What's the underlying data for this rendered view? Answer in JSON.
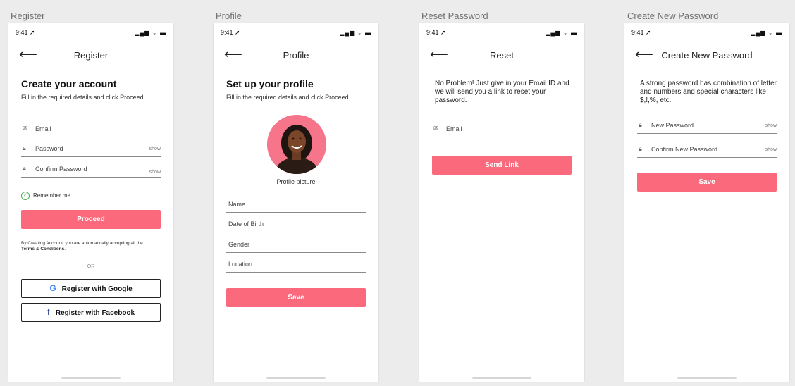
{
  "frames": [
    {
      "label": "Register"
    },
    {
      "label": "Profile"
    },
    {
      "label": "Reset Password"
    },
    {
      "label": "Create New Password"
    }
  ],
  "status": {
    "time": "9:41 ➚",
    "icons": "▂▄▆ ᯤ ▬"
  },
  "register": {
    "nav_title": "Register",
    "heading": "Create your account",
    "subtext": "Fill in the required details and click Proceed.",
    "email_label": "Email",
    "password_label": "Password",
    "password_show": "show",
    "confirm_label": "Confirm Password",
    "confirm_show": "show",
    "remember_label": "Remember me",
    "proceed_label": "Proceed",
    "terms_prefix": "By Creating Account, you are automatically accepting all the",
    "terms_link": "Terms & Conditions",
    "terms_suffix": ".",
    "or_label": "OR",
    "google_label": "Register with Google",
    "facebook_label": "Register with Facebook"
  },
  "profile": {
    "nav_title": "Profile",
    "heading": "Set up your profile",
    "subtext": "Fill in the required details and click Proceed.",
    "avatar_caption": "Profile picture",
    "name_label": "Name",
    "dob_label": "Date of Birth",
    "gender_label": "Gender",
    "location_label": "Location",
    "save_label": "Save"
  },
  "reset": {
    "nav_title": "Reset",
    "paragraph": "No Problem! Just give in your Email ID and we will send you a link to reset your password.",
    "email_label": "Email",
    "send_label": "Send Link"
  },
  "newpass": {
    "nav_title": "Create New Password",
    "paragraph": "A strong password has combination of letter and numbers and special characters like $,!,%, etc.",
    "new_label": "New Password",
    "new_show": "show",
    "confirm_label": "Confirm New Password",
    "confirm_show": "show",
    "save_label": "Save"
  },
  "colors": {
    "accent": "#fb6a7c",
    "avatar_bg": "#f7758a"
  },
  "icons": {
    "back": "arrow-left-icon",
    "mail": "envelope-icon",
    "lock": "lock-icon",
    "check": "check-circle-icon",
    "google": "google-logo-icon",
    "facebook": "facebook-logo-icon"
  }
}
